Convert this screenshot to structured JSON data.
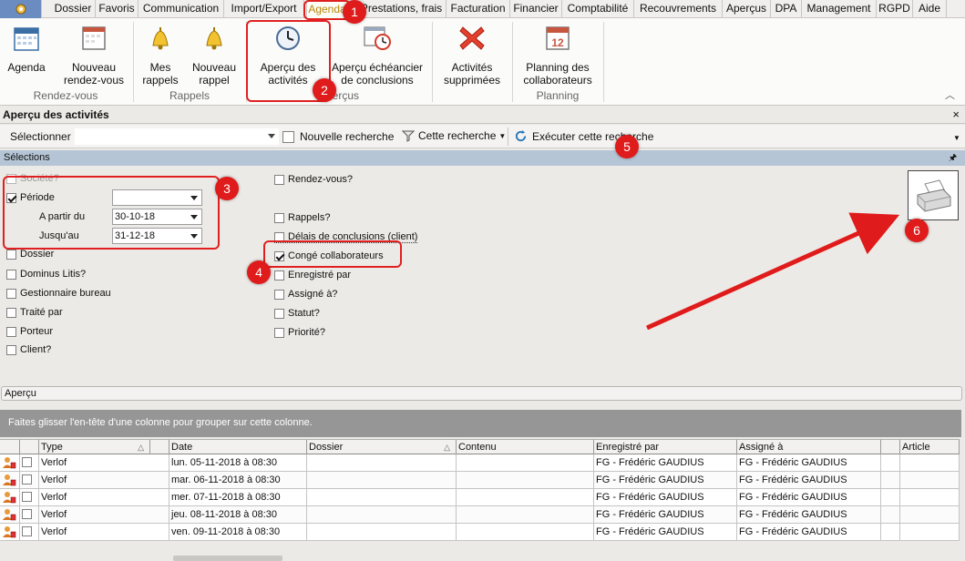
{
  "menu": {
    "gear_icon": "gear-icon",
    "items": [
      "Dossier",
      "Favoris",
      "Communication",
      "Import/Export",
      "Agenda",
      "Prestations, frais",
      "Facturation",
      "Financier",
      "Comptabilité",
      "Recouvrements",
      "Aperçus",
      "DPA",
      "Management",
      "RGPD",
      "Aide"
    ],
    "active": "Agenda"
  },
  "ribbon": {
    "buttons": [
      {
        "line1": "Agenda",
        "line2": ""
      },
      {
        "line1": "Nouveau",
        "line2": "rendez-vous"
      },
      {
        "line1": "Mes",
        "line2": "rappels"
      },
      {
        "line1": "Nouveau",
        "line2": "rappel"
      },
      {
        "line1": "Aperçu des",
        "line2": "activités"
      },
      {
        "line1": "Aperçu échéancier",
        "line2": "de conclusions"
      },
      {
        "line1": "Activités",
        "line2": "supprimées"
      },
      {
        "line1": "Planning des",
        "line2": "collaborateurs"
      }
    ],
    "groups": [
      "Rendez-vous",
      "Rappels",
      "Aperçus",
      "Planning"
    ]
  },
  "panel": {
    "title": "Aperçu des activités",
    "close": "×"
  },
  "toolbar": {
    "select_label": "Sélectionner",
    "new_search": "Nouvelle recherche",
    "this_search": "Cette recherche",
    "execute": "Exécuter cette recherche"
  },
  "selections": {
    "header": "Sélections",
    "pin": "📌",
    "left": [
      {
        "label": "Société?",
        "checked": false,
        "disabled": true
      },
      {
        "label": "Période",
        "checked": true,
        "disabled": false
      },
      {
        "label": "A partir du",
        "value": "30-10-18"
      },
      {
        "label": "Jusqu'au",
        "value": "31-12-18"
      },
      {
        "label": "Dossier",
        "checked": false
      },
      {
        "label": "Dominus Litis?",
        "checked": false
      },
      {
        "label": "Gestionnaire bureau",
        "checked": false
      },
      {
        "label": "Traité par",
        "checked": false
      },
      {
        "label": "Porteur",
        "checked": false
      },
      {
        "label": "Client?",
        "checked": false
      }
    ],
    "right": [
      {
        "label": "Rendez-vous?",
        "checked": false
      },
      {
        "label": "Rappels?",
        "checked": false
      },
      {
        "label": "Délais de conclusions (client)",
        "checked": false
      },
      {
        "label": "Congé collaborateurs",
        "checked": true
      },
      {
        "label": "Enregistré par",
        "checked": false
      },
      {
        "label": "Assigné à?",
        "checked": false
      },
      {
        "label": "Statut?",
        "checked": false
      },
      {
        "label": "Priorité?",
        "checked": false
      }
    ],
    "print_icon": "printer-icon"
  },
  "apercu": {
    "label": "Aperçu",
    "group_hint": "Faites glisser l'en-tête d'une colonne pour grouper sur cette colonne."
  },
  "grid": {
    "columns": [
      "Type",
      "Date",
      "Dossier",
      "Contenu",
      "Enregistré par",
      "Assigné à",
      "Article"
    ],
    "rows": [
      {
        "type": "Verlof",
        "date": "lun. 05-11-2018 à 08:30",
        "dossier": "",
        "contenu": "",
        "enregistre": "FG - Frédéric GAUDIUS",
        "assigne": "FG - Frédéric GAUDIUS",
        "article": ""
      },
      {
        "type": "Verlof",
        "date": "mar. 06-11-2018 à 08:30",
        "dossier": "",
        "contenu": "",
        "enregistre": "FG - Frédéric GAUDIUS",
        "assigne": "FG - Frédéric GAUDIUS",
        "article": ""
      },
      {
        "type": "Verlof",
        "date": "mer. 07-11-2018 à 08:30",
        "dossier": "",
        "contenu": "",
        "enregistre": "FG - Frédéric GAUDIUS",
        "assigne": "FG - Frédéric GAUDIUS",
        "article": ""
      },
      {
        "type": "Verlof",
        "date": "jeu. 08-11-2018 à 08:30",
        "dossier": "",
        "contenu": "",
        "enregistre": "FG - Frédéric GAUDIUS",
        "assigne": "FG - Frédéric GAUDIUS",
        "article": ""
      },
      {
        "type": "Verlof",
        "date": "ven. 09-11-2018 à 08:30",
        "dossier": "",
        "contenu": "",
        "enregistre": "FG - Frédéric GAUDIUS",
        "assigne": "FG - Frédéric GAUDIUS",
        "article": ""
      }
    ]
  },
  "annotations": [
    "1",
    "2",
    "3",
    "4",
    "5",
    "6"
  ]
}
